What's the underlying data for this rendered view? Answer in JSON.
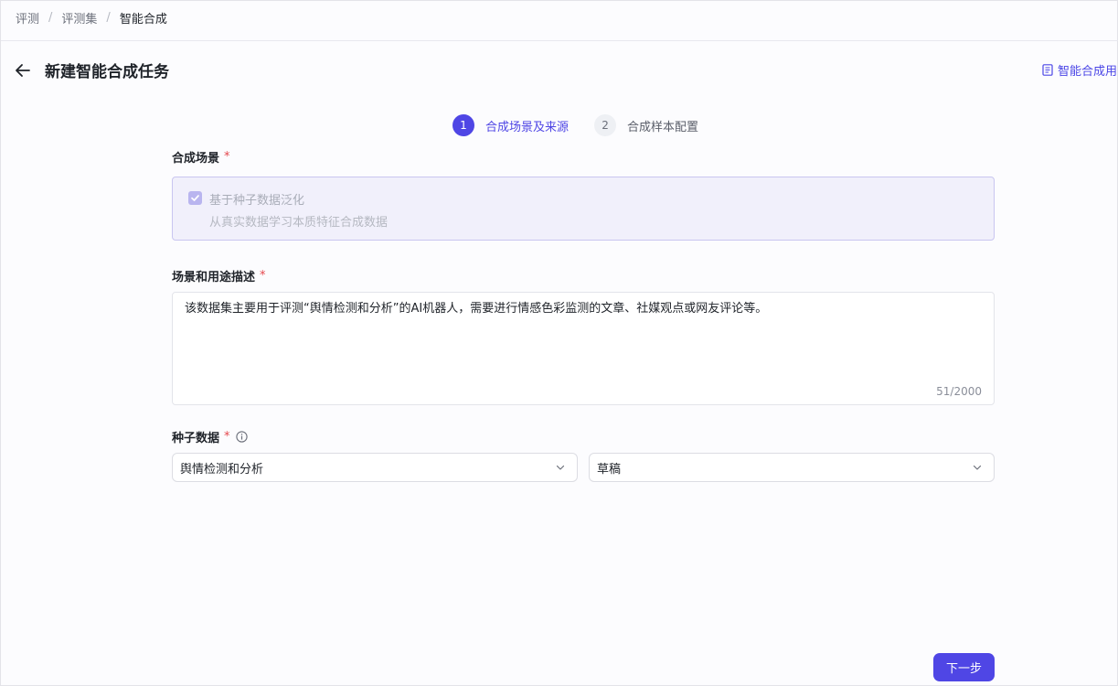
{
  "breadcrumb": [
    "评测",
    "评测集",
    "智能合成"
  ],
  "breadcrumb_sep": "/",
  "header": {
    "title": "新建智能合成任务",
    "guide_link": "智能合成用"
  },
  "steps": [
    {
      "num": "1",
      "label": "合成场景及来源"
    },
    {
      "num": "2",
      "label": "合成样本配置"
    }
  ],
  "form": {
    "scenario_label": "合成场景",
    "required_mark": "*",
    "scenario_option_title": "基于种子数据泛化",
    "scenario_option_desc": "从真实数据学习本质特征合成数据",
    "desc_label": "场景和用途描述",
    "desc_value": "该数据集主要用于评测“舆情检测和分析”的AI机器人，需要进行情感色彩监测的文章、社媒观点或网友评论等。",
    "desc_count": "51/2000",
    "seed_label": "种子数据",
    "seed_dataset": "舆情检测和分析",
    "seed_version": "草稿"
  },
  "footer": {
    "next_label": "下一步"
  },
  "colors": {
    "accent": "#4f46e5",
    "required": "#e5484d"
  }
}
